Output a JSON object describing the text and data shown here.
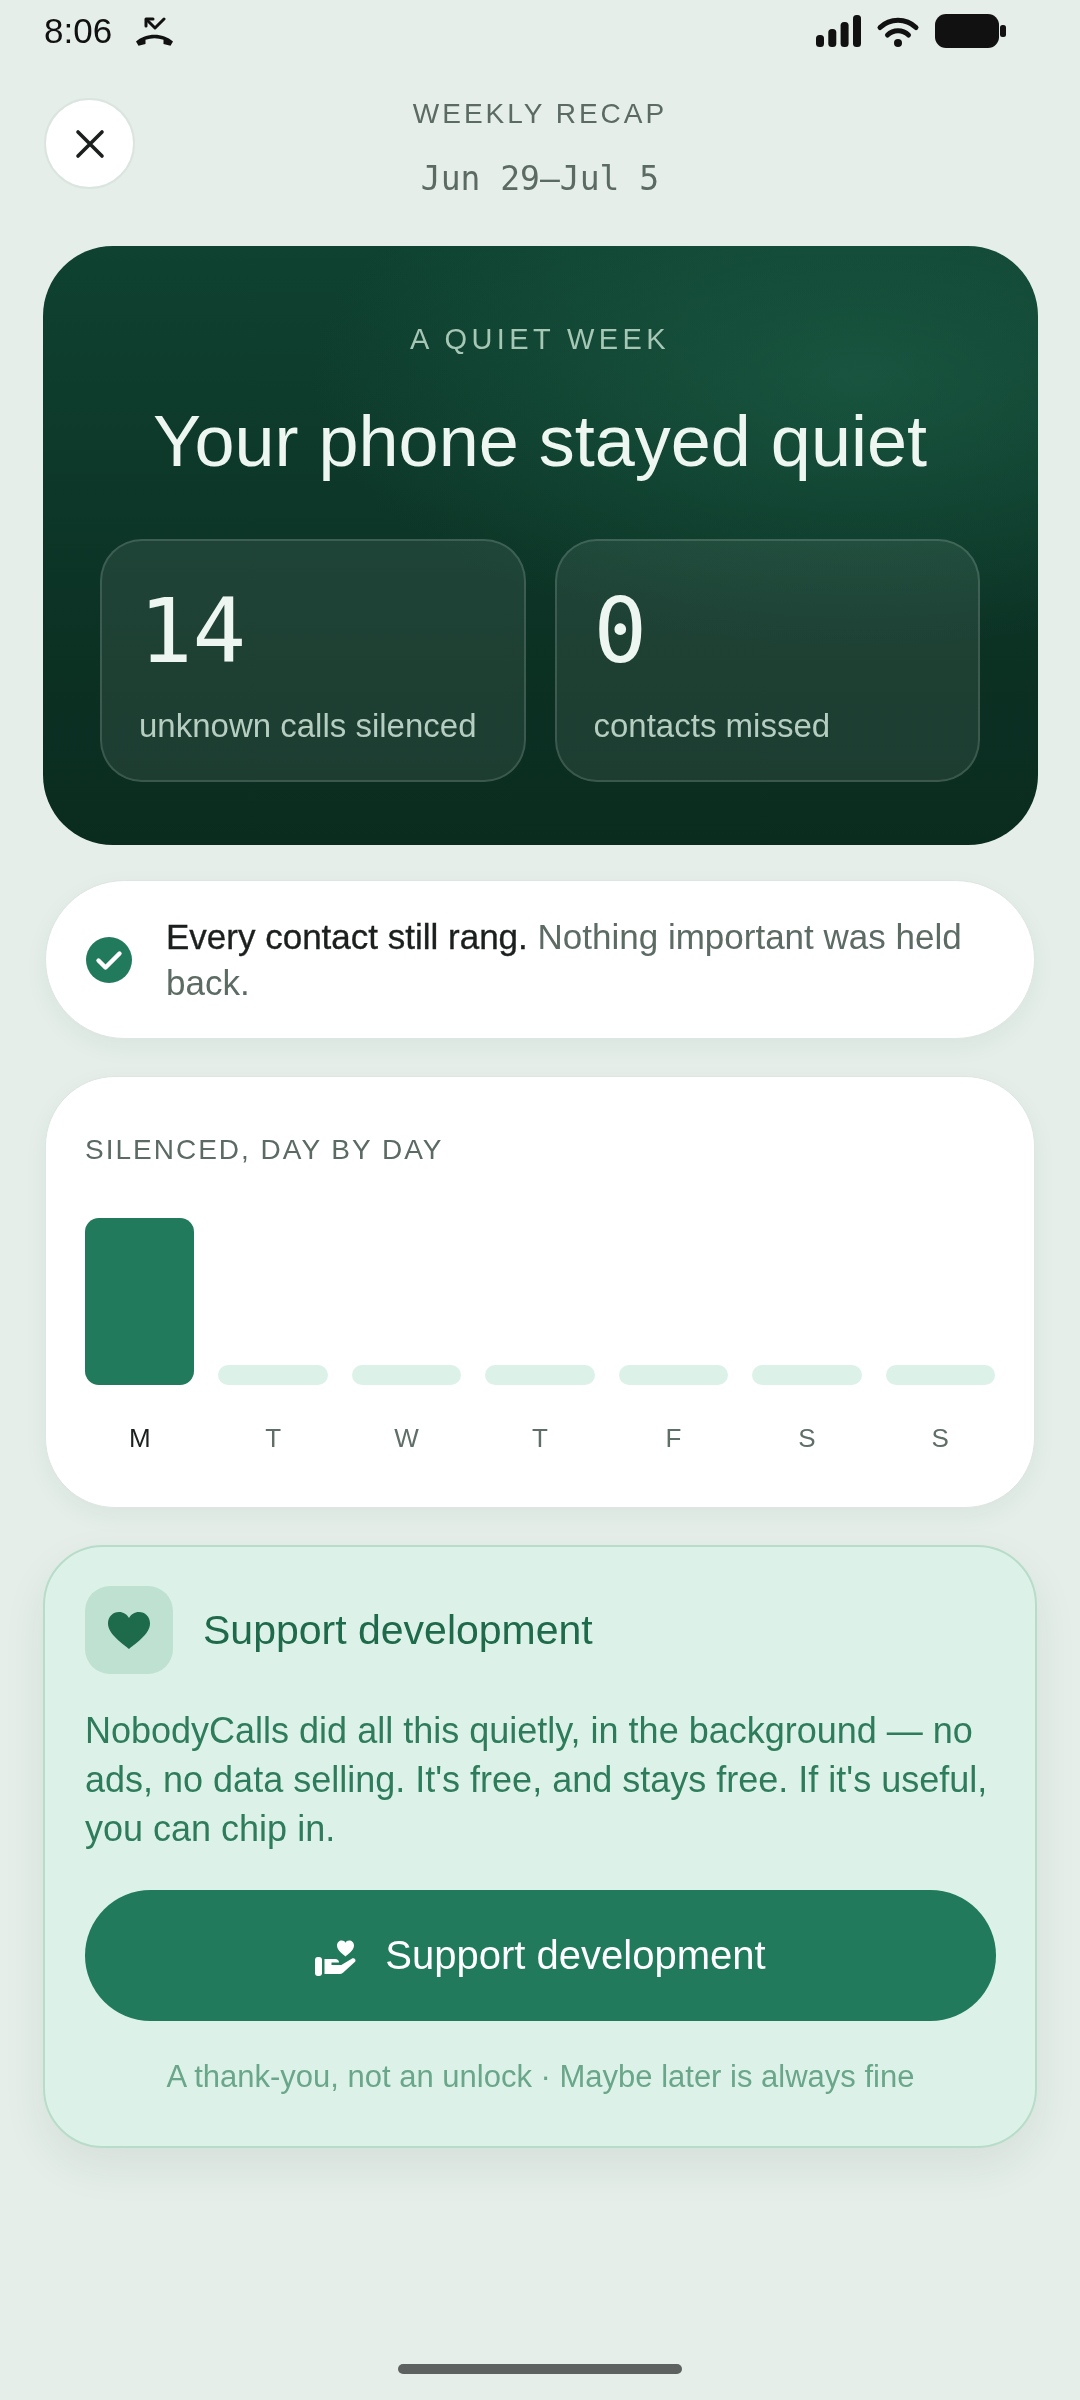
{
  "status_bar": {
    "time": "8:06"
  },
  "header": {
    "title": "WEEKLY RECAP",
    "date_range": "Jun 29–Jul 5"
  },
  "summary": {
    "eyebrow": "A QUIET WEEK",
    "headline": "Your phone stayed quiet",
    "stats": [
      {
        "value": "14",
        "label": "unknown calls silenced"
      },
      {
        "value": "0",
        "label": "contacts missed"
      }
    ]
  },
  "notice": {
    "message": "**Every contact still rang.** Nothing important was held back."
  },
  "daily_chart": {
    "title": "SILENCED, DAY BY DAY",
    "days": [
      {
        "label": "M",
        "active": true
      },
      {
        "label": "T",
        "active": false
      },
      {
        "label": "W",
        "active": false
      },
      {
        "label": "T",
        "active": false
      },
      {
        "label": "F",
        "active": false
      },
      {
        "label": "S",
        "active": false
      },
      {
        "label": "S",
        "active": false
      }
    ]
  },
  "support": {
    "title": "Support development",
    "body": "NobodyCalls did all this quietly, in the background — no ads, no data selling. It's free, and stays free. If it's useful, you can chip in.",
    "button": "Support development",
    "footnote": "A thank-you, not an unlock · Maybe later is always fine"
  }
}
